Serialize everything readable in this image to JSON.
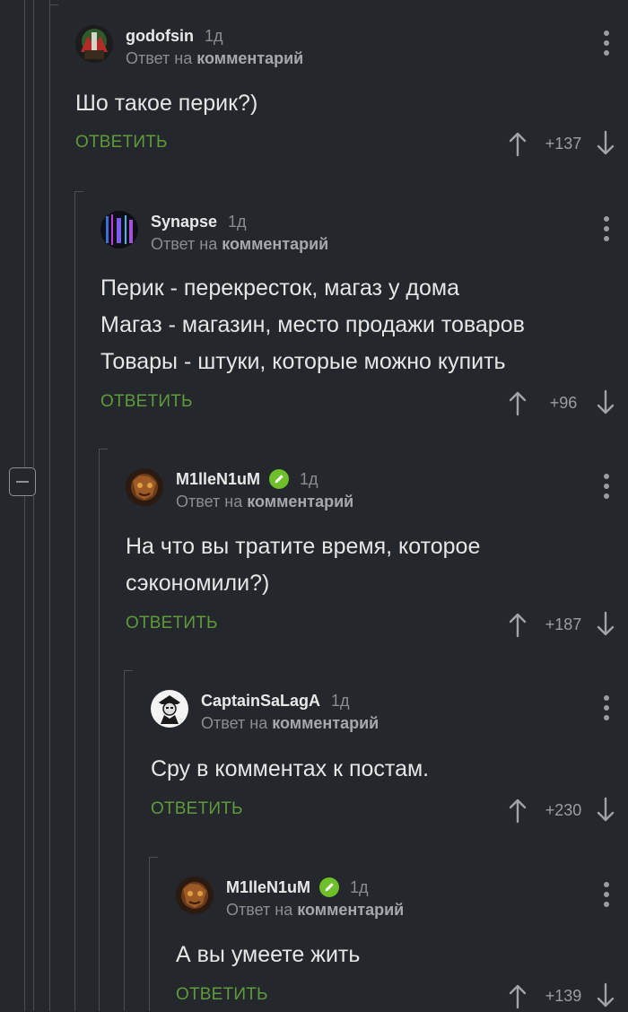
{
  "ui": {
    "reply_prefix": "Ответ на",
    "reply_target": "комментарий",
    "reply_button": "ОТВЕТИТЬ",
    "collapse_icon": "minus-square-icon",
    "menu_icon": "more-vert-icon",
    "upvote_icon": "arrow-up-icon",
    "downvote_icon": "arrow-down-icon",
    "verified_icon": "pencil-badge-icon"
  },
  "colors": {
    "background": "#24272b",
    "accent_green": "#5f9a3c",
    "verified_badge": "#6fbf2a",
    "thread_line": "#4a4e54"
  },
  "comments": [
    {
      "author": "godofsin",
      "time": "1д",
      "verified": false,
      "avatar": "avatar-godofsin",
      "lines": [
        "Шо такое перик?)"
      ],
      "score": "+137"
    },
    {
      "author": "Synapse",
      "time": "1д",
      "verified": false,
      "avatar": "avatar-synapse",
      "lines": [
        "Перик - перекресток, магаз у дома",
        "Магаз - магазин, место продажи товаров",
        "Товары - штуки, которые можно купить"
      ],
      "score": "+96"
    },
    {
      "author": "M1lleN1uM",
      "time": "1д",
      "verified": true,
      "avatar": "avatar-millenium",
      "lines": [
        "На что вы тратите время, которое",
        "сэкономили?)"
      ],
      "score": "+187"
    },
    {
      "author": "CaptainSaLagA",
      "time": "1д",
      "verified": false,
      "avatar": "avatar-captainsalaga",
      "lines": [
        "Сру в комментах к постам."
      ],
      "score": "+230"
    },
    {
      "author": "M1lleN1uM",
      "time": "1д",
      "verified": true,
      "avatar": "avatar-millenium",
      "lines": [
        "А вы умеете жить"
      ],
      "score": "+139"
    }
  ]
}
